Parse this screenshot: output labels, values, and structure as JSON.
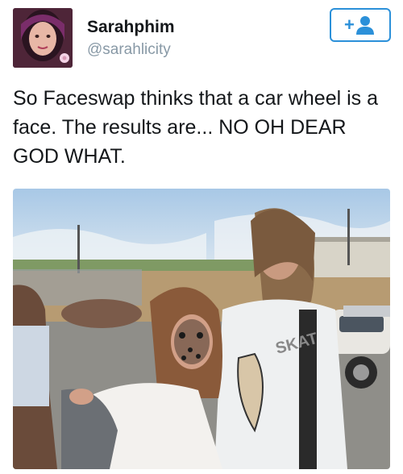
{
  "user": {
    "display_name": "Sarahphim",
    "handle": "@sarahlicity",
    "avatar_icon": "profile-photo"
  },
  "follow_button": {
    "icon": "add-user-icon",
    "accent": "#2b90d9"
  },
  "tweet": {
    "text": "So Faceswap thinks that a car wheel is a face. The results are... NO OH DEAR GOD WHAT."
  },
  "photo": {
    "shirt_print": "SKAT"
  }
}
